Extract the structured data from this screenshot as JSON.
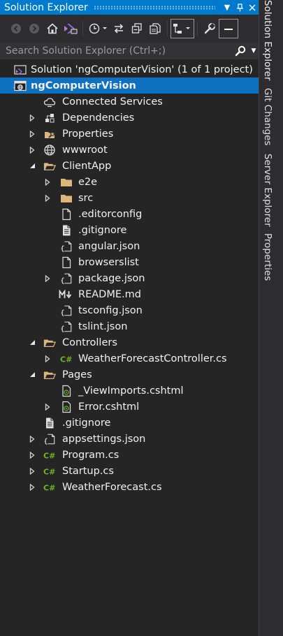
{
  "panel": {
    "title": "Solution Explorer",
    "search_placeholder": "Search Solution Explorer (Ctrl+;)"
  },
  "titlebar_buttons": [
    "dropdown",
    "pin",
    "close"
  ],
  "toolbar_icons": [
    "back-icon",
    "forward-icon",
    "home-icon",
    "vs-switch-views-icon",
    "pending-changes-filter-icon",
    "sync-icon",
    "collapse-all-icon",
    "show-all-files-icon",
    "preview-selected-icon",
    "properties-wrench-icon",
    "dash-icon"
  ],
  "tree": [
    {
      "label": "Solution 'ngComputerVision' (1 of 1 project)",
      "icon": "solution",
      "level": 0,
      "arrow": "none"
    },
    {
      "label": "ngComputerVision",
      "icon": "web-project",
      "level": 0,
      "arrow": "expanded",
      "selected": true,
      "bold": true
    },
    {
      "label": "Connected Services",
      "icon": "cloud",
      "level": 1,
      "arrow": "none"
    },
    {
      "label": "Dependencies",
      "icon": "dependencies",
      "level": 1,
      "arrow": "collapsed"
    },
    {
      "label": "Properties",
      "icon": "properties",
      "level": 1,
      "arrow": "collapsed"
    },
    {
      "label": "wwwroot",
      "icon": "globe",
      "level": 1,
      "arrow": "collapsed"
    },
    {
      "label": "ClientApp",
      "icon": "folder-open",
      "level": 1,
      "arrow": "expanded"
    },
    {
      "label": "e2e",
      "icon": "folder",
      "level": 2,
      "arrow": "collapsed"
    },
    {
      "label": "src",
      "icon": "folder",
      "level": 2,
      "arrow": "collapsed"
    },
    {
      "label": ".editorconfig",
      "icon": "file",
      "level": 2,
      "arrow": "none"
    },
    {
      "label": ".gitignore",
      "icon": "file-text",
      "level": 2,
      "arrow": "none"
    },
    {
      "label": "angular.json",
      "icon": "json",
      "level": 2,
      "arrow": "none"
    },
    {
      "label": "browserslist",
      "icon": "file",
      "level": 2,
      "arrow": "none"
    },
    {
      "label": "package.json",
      "icon": "json",
      "level": 2,
      "arrow": "collapsed"
    },
    {
      "label": "README.md",
      "icon": "markdown",
      "level": 2,
      "arrow": "none"
    },
    {
      "label": "tsconfig.json",
      "icon": "json",
      "level": 2,
      "arrow": "none"
    },
    {
      "label": "tslint.json",
      "icon": "json",
      "level": 2,
      "arrow": "none"
    },
    {
      "label": "Controllers",
      "icon": "folder-open",
      "level": 1,
      "arrow": "expanded"
    },
    {
      "label": "WeatherForecastController.cs",
      "icon": "csharp",
      "level": 2,
      "arrow": "collapsed"
    },
    {
      "label": "Pages",
      "icon": "folder-open",
      "level": 1,
      "arrow": "expanded"
    },
    {
      "label": "_ViewImports.cshtml",
      "icon": "razor",
      "level": 2,
      "arrow": "none"
    },
    {
      "label": "Error.cshtml",
      "icon": "razor",
      "level": 2,
      "arrow": "collapsed"
    },
    {
      "label": ".gitignore",
      "icon": "file-text",
      "level": 1,
      "arrow": "none"
    },
    {
      "label": "appsettings.json",
      "icon": "json",
      "level": 1,
      "arrow": "collapsed"
    },
    {
      "label": "Program.cs",
      "icon": "csharp",
      "level": 1,
      "arrow": "collapsed"
    },
    {
      "label": "Startup.cs",
      "icon": "csharp",
      "level": 1,
      "arrow": "collapsed"
    },
    {
      "label": "WeatherForecast.cs",
      "icon": "csharp",
      "level": 1,
      "arrow": "collapsed"
    }
  ],
  "dock_tabs": [
    "Solution Explorer",
    "Git Changes",
    "Server Explorer",
    "Properties"
  ],
  "colors": {
    "accent": "#007acc",
    "selection": "#0e70c0",
    "background": "#252526",
    "folder": "#dcb67a",
    "csharp": "#68b723",
    "vs_purple": "#8e6cd8"
  }
}
